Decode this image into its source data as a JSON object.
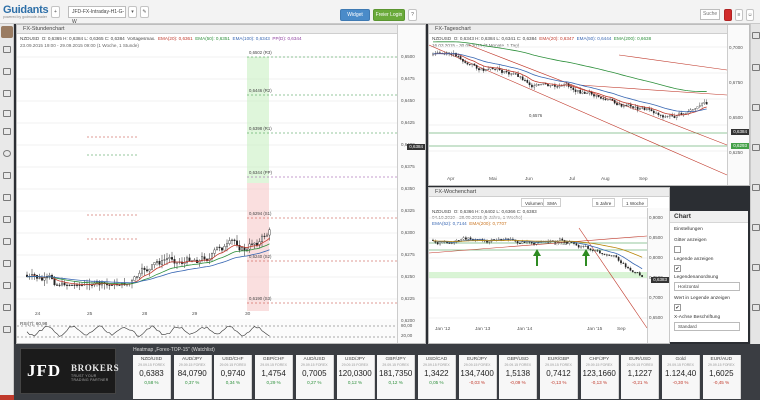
{
  "app": {
    "logo": "Guidants",
    "logo_sub": "powered by godmode-trader",
    "workspace_select": "JFD-FX-Intraday-H1-G-W",
    "buttons": {
      "add": "+",
      "help": "?",
      "widget_label": "Widget",
      "login_label": "Freier Login",
      "search": "Suche"
    }
  },
  "hourly_panel": {
    "title": "FX-Stundenchart",
    "info_line1": {
      "symbol": "NZDUSD",
      "ohlc": "O: 0,6365  H: 0,6384  L: 0,6365  C: 0,6384",
      "vortag": "Vortagesmax.",
      "ema20": "EMA(20): 0,6361",
      "ema50": "EMA(50): 0,6351",
      "ema100": "EMA(100): 0,6343",
      "pp": "PP(D): 0,6344"
    },
    "info_line2": "23.09.2015 19:00 - 29.09.2015 09:00 (1 Woche, 1 Stunde)",
    "y_ticks": [
      "0,6500",
      "0,6475",
      "0,6450",
      "0,6425",
      "0,6400",
      "0,6375",
      "0,6350",
      "0,6325",
      "0,6300",
      "0,6275",
      "0,6250",
      "0,6225",
      "0,6200"
    ],
    "last_price": "0,6384",
    "level_labels": [
      "0,6502 (R3)",
      "0,6446 (R2)",
      "0,6398 (R1)",
      "0,6344 (PP)",
      "0,6294 (S1)",
      "0,6240 (S2)",
      "0,6190 (S3)"
    ],
    "x_labels": [
      "24",
      "25",
      "28",
      "29",
      "30"
    ],
    "rsi_title": "RSI(7): 60,98",
    "rsi_ticks": [
      "80,00",
      "20,00"
    ]
  },
  "daily_panel": {
    "title": "FX-Tageschart",
    "info_line1": {
      "symbol": "NZDUSD",
      "ohlc": "O: 0,6343  H: 0,6384  L: 0,6341  C: 0,6384",
      "ema20": "EMA(20): 0,6347",
      "ema50": "EMA(50): 0,6444",
      "ema200": "EMA(200): 0,6638"
    },
    "info_line2": "16.03.2015 - 30.09.2015 (7 Monate, 1 Tag)",
    "y_ticks": [
      "0,7000",
      "0,6750",
      "0,6500",
      "0,6250"
    ],
    "price_tags": [
      "0,6384",
      "0,6293"
    ],
    "trend_label": "0,6576",
    "x_labels": [
      "Apr",
      "Mai",
      "Jun",
      "Jul",
      "Aug",
      "Sep"
    ]
  },
  "weekly_panel": {
    "title": "FX-Wochenchart",
    "toolbar": [
      "Volumen",
      "SMA",
      "5 Jahre",
      "1 Woche",
      "1 Woche"
    ],
    "info_line1": {
      "symbol": "NZDUSD",
      "ohlc": "O: 0,6366  H: 0,6402  L: 0,6366  C: 0,6383",
      "ema50": "EMA(52): 0,7144",
      "ema200": "EMA(200): 0,7707"
    },
    "info_line2": "04.10.2010 - 28.09.2015 (5 Jahre, 1 Woche)",
    "y_ticks": [
      "0,9000",
      "0,8500",
      "0,8000",
      "0,7500",
      "0,7000",
      "0,6500"
    ],
    "price_tag": "0,6383",
    "level_labels": [
      "0,7733"
    ],
    "x_labels": [
      "Jan '12",
      "Jan '13",
      "Jan '14",
      "Jan '15",
      "Sep"
    ]
  },
  "chart_settings": {
    "title": "Chart",
    "settings_label": "Einstellungen",
    "grid_label": "Gitter anzeigen",
    "legend_label": "Legende anzeigen",
    "legend_position_label": "Legendenanordnung",
    "legend_position_value": "Horizontal",
    "values_in_legend_label": "Wert in Legende anzeigen",
    "x_axis_label": "X-Achse Beschriftung",
    "x_axis_value": "Standard",
    "grid_checked": "",
    "legend_checked": "✔",
    "values_checked": "✔"
  },
  "branding": {
    "brand": "JFD",
    "brand_suffix": "BROKERS",
    "tagline": "TRUST YOUR TRADING PARTNER"
  },
  "watchlist": {
    "title": "Heatmap „Forex-TOP-15\" (Watchlist)",
    "items": [
      {
        "sym": "NZD/USD",
        "time": "29.09.15 FOREX",
        "price": "0,6383",
        "chg": "0,58 %",
        "dir": "up"
      },
      {
        "sym": "AUD/JPY",
        "time": "29.09.15 FOREX",
        "price": "84,0790",
        "chg": "0,37 %",
        "dir": "up"
      },
      {
        "sym": "USD/CHF",
        "time": "29.09.15 FOREX",
        "price": "0,9740",
        "chg": "0,34 %",
        "dir": "up"
      },
      {
        "sym": "GBP/CHF",
        "time": "29.09.15 FOREX",
        "price": "1,4754",
        "chg": "0,29 %",
        "dir": "up"
      },
      {
        "sym": "AUD/USD",
        "time": "29.09.15 FOREX",
        "price": "0,7005",
        "chg": "0,27 %",
        "dir": "up"
      },
      {
        "sym": "USD/JPY",
        "time": "29.09.15 FOREX",
        "price": "120,0300",
        "chg": "0,12 %",
        "dir": "up"
      },
      {
        "sym": "GBP/JPY",
        "time": "29.09.15 FOREX",
        "price": "181,7350",
        "chg": "0,12 %",
        "dir": "up"
      },
      {
        "sym": "USD/CAD",
        "time": "29.09.15 FOREX",
        "price": "1,3422",
        "chg": "0,05 %",
        "dir": "up"
      },
      {
        "sym": "EUR/JPY",
        "time": "29.09.15 FOREX",
        "price": "134,7400",
        "chg": "-0,03 %",
        "dir": "down"
      },
      {
        "sym": "GBP/USD",
        "time": "29.09.15 FOREX",
        "price": "1,5138",
        "chg": "-0,09 %",
        "dir": "down"
      },
      {
        "sym": "EUR/GBP",
        "time": "29.09.15 FOREX",
        "price": "0,7412",
        "chg": "-0,13 %",
        "dir": "down"
      },
      {
        "sym": "CHF/JPY",
        "time": "29.09.15 FOREX",
        "price": "123,1660",
        "chg": "-0,13 %",
        "dir": "down"
      },
      {
        "sym": "EUR/USD",
        "time": "29.09.15 FOREX",
        "price": "1,1227",
        "chg": "-0,21 %",
        "dir": "down"
      },
      {
        "sym": "Gold",
        "time": "29.09.15 FOREX",
        "price": "1.124,40",
        "chg": "-0,30 %",
        "dir": "down"
      },
      {
        "sym": "EUR/AUD",
        "time": "29.09.15 FOREX",
        "price": "1,6025",
        "chg": "-0,45 %",
        "dir": "down"
      }
    ]
  },
  "colors": {
    "accent": "#4a8bc9",
    "green": "#2c8f3a",
    "red": "#c0392b",
    "ema20": "#c0392b",
    "ema50": "#2c8f3a",
    "ema100": "#3867b3",
    "pp": "#8c3e9e",
    "ema200": "#b8860b"
  }
}
